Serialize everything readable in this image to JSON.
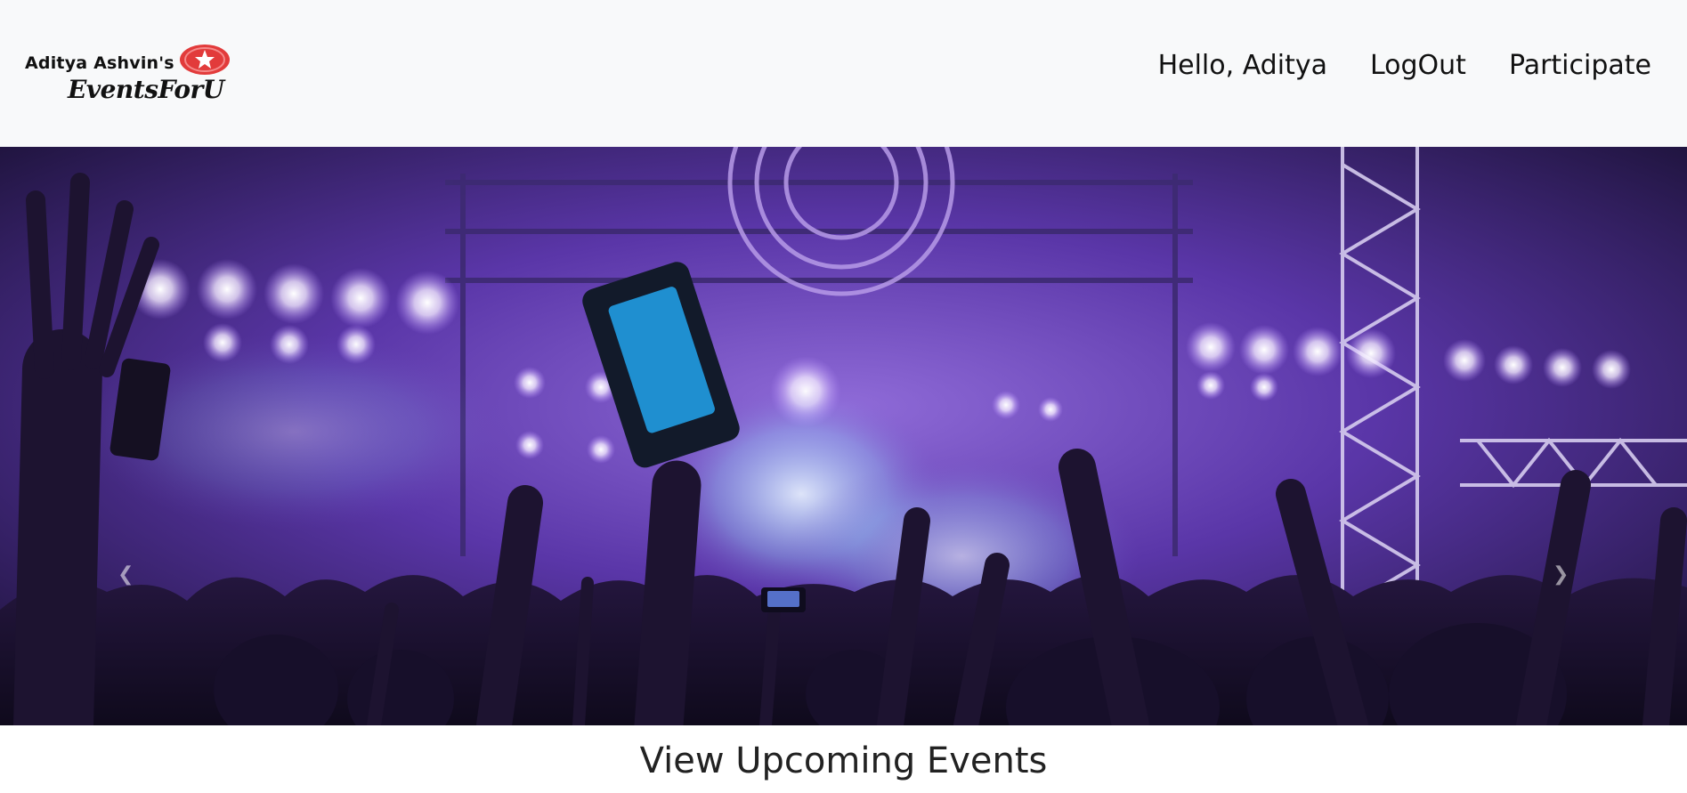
{
  "brand": {
    "line1": "Aditya Ashvin's",
    "line2": "EventsForU",
    "star_color": "#e23b3b"
  },
  "nav": {
    "greeting": "Hello, Aditya",
    "logout": "LogOut",
    "participate": "Participate"
  },
  "hero": {
    "prev_icon": "chevron-left-icon",
    "next_icon": "chevron-right-icon"
  },
  "section": {
    "title": "View Upcoming Events"
  }
}
